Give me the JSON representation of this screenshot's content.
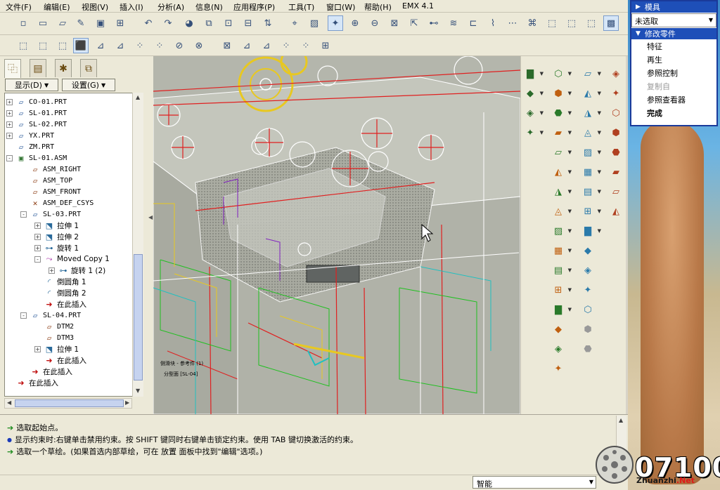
{
  "menubar": [
    "文件(F)",
    "编辑(E)",
    "视图(V)",
    "插入(I)",
    "分析(A)",
    "信息(N)",
    "应用程序(P)",
    "工具(T)",
    "窗口(W)",
    "帮助(H)",
    "EMX 4.1"
  ],
  "left_panel": {
    "display_button": "显示(D)",
    "settings_button": "设置(G)"
  },
  "model_tree": [
    {
      "label": "CO-01.PRT",
      "icon": "part-icon",
      "expander": "+"
    },
    {
      "label": "SL-01.PRT",
      "icon": "part-icon",
      "expander": "+"
    },
    {
      "label": "SL-02.PRT",
      "icon": "part-icon",
      "expander": "+"
    },
    {
      "label": "YX.PRT",
      "icon": "part-icon",
      "expander": "+"
    },
    {
      "label": "ZM.PRT",
      "icon": "part-icon",
      "expander": ""
    },
    {
      "label": "SL-01.ASM",
      "icon": "assembly-icon",
      "expander": "-"
    },
    {
      "label": "ASM_RIGHT",
      "icon": "datum-plane-icon",
      "expander": ""
    },
    {
      "label": "ASM_TOP",
      "icon": "datum-plane-icon",
      "expander": ""
    },
    {
      "label": "ASM_FRONT",
      "icon": "datum-plane-icon",
      "expander": ""
    },
    {
      "label": "ASM_DEF_CSYS",
      "icon": "csys-icon",
      "expander": ""
    },
    {
      "label": "SL-03.PRT",
      "icon": "part-icon",
      "expander": "-"
    },
    {
      "label": "拉伸 1",
      "icon": "extrude-icon",
      "expander": "+"
    },
    {
      "label": "拉伸 2",
      "icon": "extrude-icon",
      "expander": "+"
    },
    {
      "label": "旋转 1",
      "icon": "revolve-icon",
      "expander": "+"
    },
    {
      "label": "Moved Copy 1",
      "icon": "copy-icon",
      "expander": "-"
    },
    {
      "label": "旋转 1 (2)",
      "icon": "revolve-icon",
      "expander": "+"
    },
    {
      "label": "倒圆角 1",
      "icon": "round-icon",
      "expander": ""
    },
    {
      "label": "倒圆角 2",
      "icon": "round-icon",
      "expander": ""
    },
    {
      "label": "在此插入",
      "icon": "insert-here-icon",
      "expander": ""
    },
    {
      "label": "SL-04.PRT",
      "icon": "part-icon",
      "expander": "-"
    },
    {
      "label": "DTM2",
      "icon": "datum-plane-icon",
      "expander": ""
    },
    {
      "label": "DTM3",
      "icon": "datum-plane-icon",
      "expander": ""
    },
    {
      "label": "拉伸 1",
      "icon": "extrude-icon",
      "expander": "+"
    },
    {
      "label": "在此插入",
      "icon": "insert-here-icon",
      "expander": ""
    },
    {
      "label": "在此插入",
      "icon": "insert-here-icon",
      "expander": ""
    },
    {
      "label": "在此插入",
      "icon": "insert-here-icon",
      "expander": ""
    }
  ],
  "menu_manager": {
    "header": "模具",
    "selection": "未选取",
    "submenu": "修改零件",
    "items": [
      {
        "label": "特征",
        "state": "normal"
      },
      {
        "label": "再生",
        "state": "normal"
      },
      {
        "label": "参照控制",
        "state": "normal"
      },
      {
        "label": "复制自",
        "state": "disabled"
      },
      {
        "label": "参照查看器",
        "state": "normal"
      },
      {
        "label": "完成",
        "state": "bold"
      }
    ]
  },
  "messages": [
    {
      "icon": "arrow-icon",
      "text": "选取起始点。"
    },
    {
      "icon": "info-dot-icon",
      "text": "显示约束时:右键单击禁用约束。按 SHIFT 键同时右键单击锁定约束。使用 TAB 键切换激活的约束。"
    },
    {
      "icon": "arrow-icon",
      "text": "选取一个草绘。(如果首选内部草绘，可在 放置 面板中找到\"编辑\"选项。)"
    }
  ],
  "status": {
    "filter_value": "智能"
  },
  "watermark": {
    "number": "07100",
    "site": "Zhuanzhi",
    "site_tld": ".Net"
  },
  "viewport_labels": {
    "label_a": "分型面 [SL-04]",
    "label_b": "侧滑块 - 参考件 (1)"
  },
  "colors": {
    "accent": "#1e4fb8",
    "insert_arrow": "#c01010",
    "message_arrow": "#1a8a1a",
    "info_dot": "#1a3ab8"
  }
}
